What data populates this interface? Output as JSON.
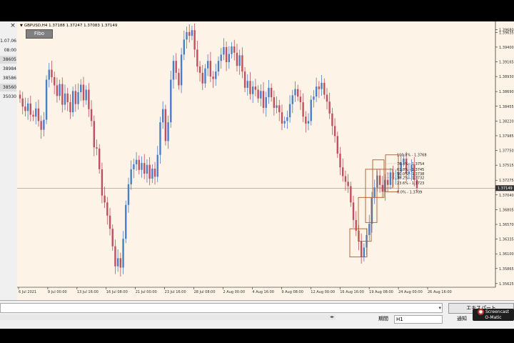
{
  "chart_data": {
    "type": "candlestick",
    "symbol_line": "GBPUSD,H4  1.37188 1.37247 1.37083 1.37149",
    "current_price_label": "1.37149",
    "current_price": 1.37149,
    "ylim": [
      1.35589,
      1.39764
    ],
    "y_ticks": [
      "1.39680",
      "1.39635",
      "1.39400",
      "1.39165",
      "1.38930",
      "1.38690",
      "1.38455",
      "1.38220",
      "1.37985",
      "1.37750",
      "1.37515",
      "1.37275",
      "1.37040",
      "1.36805",
      "1.36570",
      "1.36335",
      "1.36100",
      "1.35865",
      "1.35625"
    ],
    "x_ticks": [
      "6 Jul 2021",
      "9 Jul 00:00",
      "13 Jul 16:00",
      "16 Jul 08:00",
      "21 Jul 00:00",
      "23 Jul 16:00",
      "28 Jul 08:00",
      "2 Aug 00:00",
      "4 Aug 16:00",
      "9 Aug 08:00",
      "12 Aug 00:00",
      "16 Aug 16:00",
      "19 Aug 08:00",
      "24 Aug 00:00",
      "26 Aug 16:00"
    ],
    "closes": [
      1.3858,
      1.3845,
      1.3838,
      1.385,
      1.3832,
      1.3829,
      1.3842,
      1.3822,
      1.3808,
      1.3824,
      1.3888,
      1.3904,
      1.3892,
      1.3879,
      1.3862,
      1.3881,
      1.3848,
      1.3866,
      1.3852,
      1.3836,
      1.387,
      1.3849,
      1.3868,
      1.388,
      1.3855,
      1.3872,
      1.3841,
      1.3822,
      1.378,
      1.3778,
      1.3745,
      1.3703,
      1.3692,
      1.3671,
      1.365,
      1.3622,
      1.359,
      1.3603,
      1.3588,
      1.3634,
      1.3688,
      1.3721,
      1.3745,
      1.3753,
      1.376,
      1.3744,
      1.3755,
      1.3738,
      1.3752,
      1.373,
      1.3746,
      1.3733,
      1.3768,
      1.382,
      1.3841,
      1.379,
      1.382,
      1.3888,
      1.3918,
      1.3899,
      1.3879,
      1.3928,
      1.3952,
      1.3964,
      1.3958,
      1.3967,
      1.3936,
      1.3909,
      1.3899,
      1.3882,
      1.3906,
      1.3918,
      1.3893,
      1.3889,
      1.3901,
      1.3918,
      1.3928,
      1.394,
      1.3916,
      1.3929,
      1.3941,
      1.3931,
      1.391,
      1.3927,
      1.3901,
      1.3875,
      1.3886,
      1.3865,
      1.3877,
      1.3872,
      1.3858,
      1.387,
      1.3843,
      1.386,
      1.3875,
      1.386,
      1.3843,
      1.3847,
      1.3836,
      1.3818,
      1.3822,
      1.3828,
      1.3849,
      1.3863,
      1.3873,
      1.3861,
      1.3852,
      1.3829,
      1.3818,
      1.3822,
      1.3856,
      1.3861,
      1.3877,
      1.3873,
      1.3883,
      1.3864,
      1.3853,
      1.3834,
      1.3814,
      1.3798,
      1.377,
      1.3748,
      1.3734,
      1.3725,
      1.3718,
      1.3692,
      1.3664,
      1.3647,
      1.363,
      1.3605,
      1.362,
      1.364,
      1.3658,
      1.37,
      1.3716,
      1.3735,
      1.372,
      1.3709,
      1.3728,
      1.372,
      1.374,
      1.3729,
      1.373,
      1.3741,
      1.3756,
      1.3762,
      1.3738,
      1.3741,
      1.3752,
      1.3728,
      1.3715
    ],
    "fibonacci": {
      "levels": [
        {
          "label": "100.0% - 1.3768",
          "price": 1.3768
        },
        {
          "label": "76.4% - 1.3754",
          "price": 1.3754
        },
        {
          "label": "61.8% - 1.3745",
          "price": 1.3745
        },
        {
          "label": "50.0% - 1.3738",
          "price": 1.3738
        },
        {
          "label": "38.2% - 1.3732",
          "price": 1.3732
        },
        {
          "label": "23.6% - 1.3723",
          "price": 1.3723
        },
        {
          "label": "0.0% - 1.3709",
          "price": 1.3709
        }
      ]
    },
    "colors": {
      "background": "#fdf3e6",
      "bull": "#4a7fc8",
      "bear": "#c05060",
      "box": "#b05a2a",
      "grid_text": "#333333",
      "price_line": "#777777"
    }
  },
  "ui": {
    "fibo_button": "Fibo",
    "close_glyph": "×",
    "left_panel_rows": [
      "1.07.06",
      "08:00",
      "38605",
      "38984",
      "38586",
      "38560",
      "35030"
    ],
    "expert_button": "エキスパート",
    "period_label": "期間",
    "period_value": "H1",
    "connect_button": "通知"
  },
  "watermark": {
    "line1": "Screencast",
    "line2": "O-Matic"
  }
}
